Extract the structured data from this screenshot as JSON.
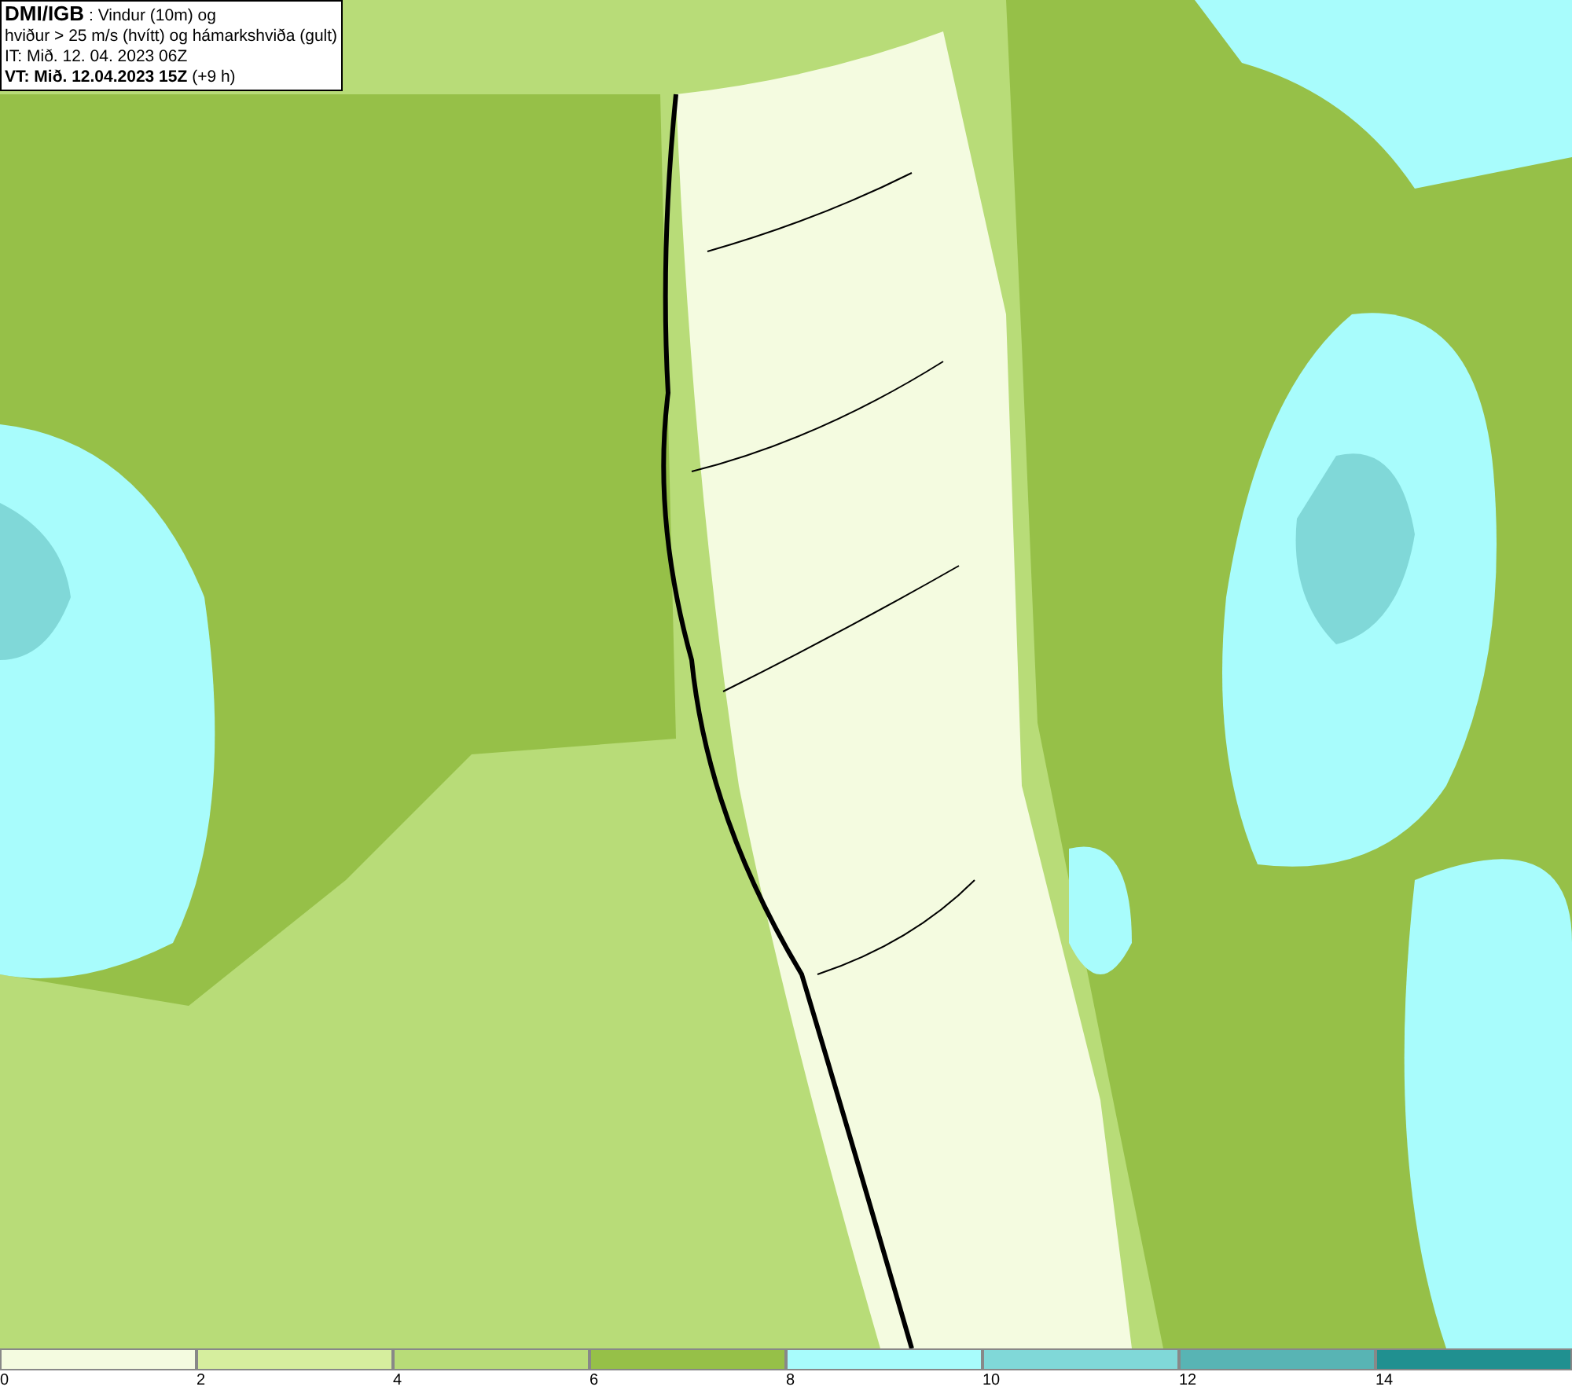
{
  "info": {
    "title": "**DMI/IGB** : Vindur (10m) og",
    "subtitle": "hviður > 25 m/s (hvítt) og hámarkshviða (gult)",
    "initial_time": "IT: Mið. 12. 04. 2023 06Z",
    "valid_time": "**VT: Mið. 12.04.2023 15Z** (+9 h)"
  },
  "legend": {
    "bins": [
      {
        "label": "0",
        "color": "#f4fbe0"
      },
      {
        "label": "2",
        "color": "#d6ee9e"
      },
      {
        "label": "4",
        "color": "#b8dc78"
      },
      {
        "label": "6",
        "color": "#96c048"
      },
      {
        "label": "8",
        "color": "#a8fcfc"
      },
      {
        "label": "10",
        "color": "#80d8d8"
      },
      {
        "label": "12",
        "color": "#58b4b4"
      },
      {
        "label": "14",
        "color": "#209090"
      }
    ]
  }
}
